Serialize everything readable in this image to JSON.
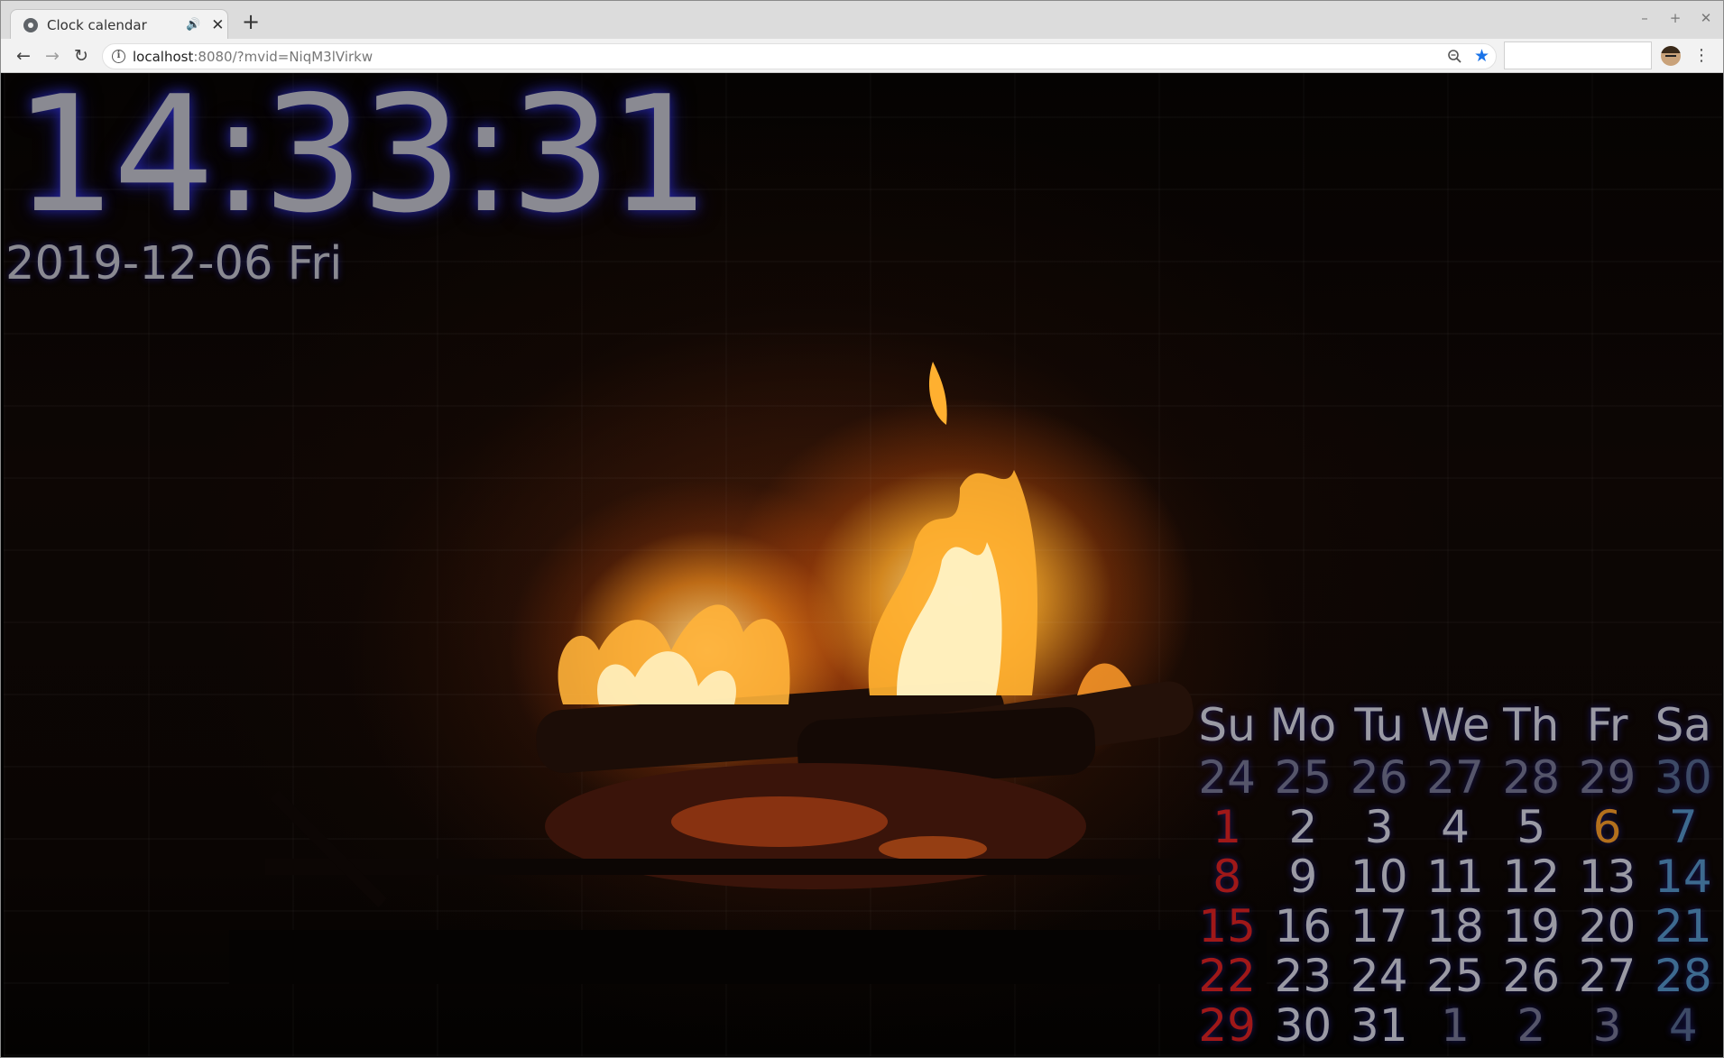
{
  "browser": {
    "tab_title": "Clock calendar",
    "new_tab_label": "+",
    "url_host": "localhost",
    "url_rest": ":8080/?mvid=NiqM3lVirkw"
  },
  "clock": {
    "time": "14:33:31",
    "date": "2019-12-06 Fri"
  },
  "calendar": {
    "weekdays": [
      "Su",
      "Mo",
      "Tu",
      "We",
      "Th",
      "Fr",
      "Sa"
    ],
    "weeks": [
      [
        {
          "d": "24",
          "other": true
        },
        {
          "d": "25",
          "other": true
        },
        {
          "d": "26",
          "other": true
        },
        {
          "d": "27",
          "other": true
        },
        {
          "d": "28",
          "other": true
        },
        {
          "d": "29",
          "other": true
        },
        {
          "d": "30",
          "other": true
        }
      ],
      [
        {
          "d": "1"
        },
        {
          "d": "2"
        },
        {
          "d": "3"
        },
        {
          "d": "4"
        },
        {
          "d": "5"
        },
        {
          "d": "6",
          "today": true
        },
        {
          "d": "7"
        }
      ],
      [
        {
          "d": "8"
        },
        {
          "d": "9"
        },
        {
          "d": "10"
        },
        {
          "d": "11"
        },
        {
          "d": "12"
        },
        {
          "d": "13"
        },
        {
          "d": "14"
        }
      ],
      [
        {
          "d": "15"
        },
        {
          "d": "16"
        },
        {
          "d": "17"
        },
        {
          "d": "18"
        },
        {
          "d": "19"
        },
        {
          "d": "20"
        },
        {
          "d": "21"
        }
      ],
      [
        {
          "d": "22"
        },
        {
          "d": "23"
        },
        {
          "d": "24"
        },
        {
          "d": "25"
        },
        {
          "d": "26"
        },
        {
          "d": "27"
        },
        {
          "d": "28"
        }
      ],
      [
        {
          "d": "29"
        },
        {
          "d": "30"
        },
        {
          "d": "31"
        },
        {
          "d": "1",
          "other": true
        },
        {
          "d": "2",
          "other": true
        },
        {
          "d": "3",
          "other": true
        },
        {
          "d": "4",
          "other": true
        }
      ]
    ]
  },
  "colors": {
    "sunday": "#a01818",
    "saturday": "#3d6a8f",
    "today": "#b3701c",
    "text": "#8a8a92",
    "glow": "#2828b4"
  },
  "icons": {
    "favicon": "globe-icon",
    "audio": "speaker-icon",
    "back": "arrow-left-icon",
    "forward": "arrow-right-icon",
    "reload": "reload-icon",
    "info": "info-icon",
    "zoom": "magnifier-icon",
    "bookmark": "star-icon",
    "menu": "kebab-menu-icon"
  }
}
